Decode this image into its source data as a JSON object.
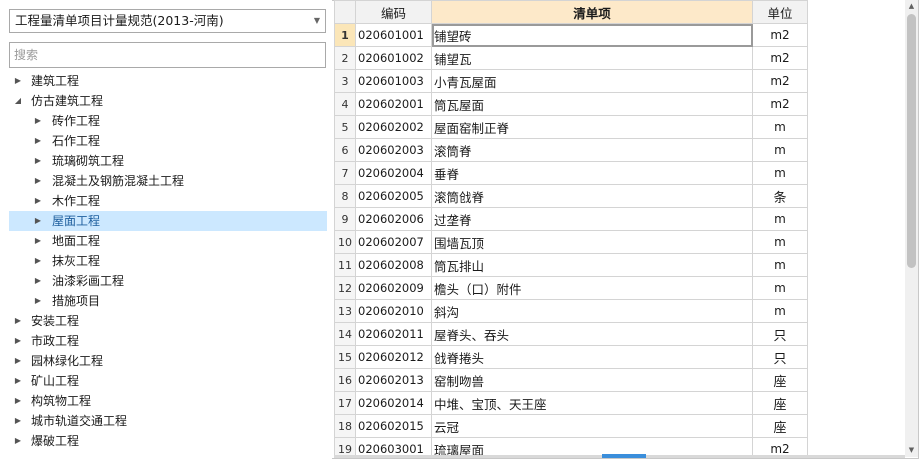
{
  "left_panel": {
    "standard_select": "工程量清单项目计量规范(2013-河南)",
    "search_placeholder": "搜索",
    "tree": [
      {
        "label": "建筑工程",
        "level": 0,
        "expanded": false
      },
      {
        "label": "仿古建筑工程",
        "level": 0,
        "expanded": true
      },
      {
        "label": "砖作工程",
        "level": 1,
        "expanded": false
      },
      {
        "label": "石作工程",
        "level": 1,
        "expanded": false
      },
      {
        "label": "琉璃砌筑工程",
        "level": 1,
        "expanded": false
      },
      {
        "label": "混凝土及钢筋混凝土工程",
        "level": 1,
        "expanded": false
      },
      {
        "label": "木作工程",
        "level": 1,
        "expanded": false
      },
      {
        "label": "屋面工程",
        "level": 1,
        "expanded": false,
        "selected": true
      },
      {
        "label": "地面工程",
        "level": 1,
        "expanded": false
      },
      {
        "label": "抹灰工程",
        "level": 1,
        "expanded": false
      },
      {
        "label": "油漆彩画工程",
        "level": 1,
        "expanded": false
      },
      {
        "label": "措施项目",
        "level": 1,
        "expanded": false
      },
      {
        "label": "安装工程",
        "level": 0,
        "expanded": false
      },
      {
        "label": "市政工程",
        "level": 0,
        "expanded": false
      },
      {
        "label": "园林绿化工程",
        "level": 0,
        "expanded": false
      },
      {
        "label": "矿山工程",
        "level": 0,
        "expanded": false
      },
      {
        "label": "构筑物工程",
        "level": 0,
        "expanded": false
      },
      {
        "label": "城市轨道交通工程",
        "level": 0,
        "expanded": false
      },
      {
        "label": "爆破工程",
        "level": 0,
        "expanded": false
      }
    ]
  },
  "grid": {
    "headers": {
      "num": "",
      "code": "编码",
      "name": "清单项",
      "unit": "单位"
    },
    "active_row": 1,
    "rows": [
      {
        "num": "1",
        "code": "020601001",
        "name": "铺望砖",
        "unit": "m2"
      },
      {
        "num": "2",
        "code": "020601002",
        "name": "铺望瓦",
        "unit": "m2"
      },
      {
        "num": "3",
        "code": "020601003",
        "name": "小青瓦屋面",
        "unit": "m2"
      },
      {
        "num": "4",
        "code": "020602001",
        "name": "筒瓦屋面",
        "unit": "m2"
      },
      {
        "num": "5",
        "code": "020602002",
        "name": "屋面窑制正脊",
        "unit": "m"
      },
      {
        "num": "6",
        "code": "020602003",
        "name": "滚筒脊",
        "unit": "m"
      },
      {
        "num": "7",
        "code": "020602004",
        "name": "垂脊",
        "unit": "m"
      },
      {
        "num": "8",
        "code": "020602005",
        "name": "滚筒戗脊",
        "unit": "条"
      },
      {
        "num": "9",
        "code": "020602006",
        "name": "过垄脊",
        "unit": "m"
      },
      {
        "num": "10",
        "code": "020602007",
        "name": "围墙瓦顶",
        "unit": "m"
      },
      {
        "num": "11",
        "code": "020602008",
        "name": "筒瓦排山",
        "unit": "m"
      },
      {
        "num": "12",
        "code": "020602009",
        "name": "檐头（口）附件",
        "unit": "m"
      },
      {
        "num": "13",
        "code": "020602010",
        "name": "斜沟",
        "unit": "m"
      },
      {
        "num": "14",
        "code": "020602011",
        "name": "屋脊头、吞头",
        "unit": "只"
      },
      {
        "num": "15",
        "code": "020602012",
        "name": "戗脊捲头",
        "unit": "只"
      },
      {
        "num": "16",
        "code": "020602013",
        "name": "窑制吻兽",
        "unit": "座"
      },
      {
        "num": "17",
        "code": "020602014",
        "name": "中堆、宝顶、天王座",
        "unit": "座"
      },
      {
        "num": "18",
        "code": "020602015",
        "name": "云冠",
        "unit": "座"
      },
      {
        "num": "19",
        "code": "020603001",
        "name": "琉璃屋面",
        "unit": "m2"
      }
    ]
  },
  "icons": {
    "dropdown": "chevron-down-icon",
    "collapsed": "caret-right-icon",
    "expanded": "caret-down-icon",
    "scroll_up": "scroll-up-arrow-icon",
    "scroll_down": "scroll-down-arrow-icon"
  },
  "colors": {
    "selection": "#cce8ff",
    "header_highlight": "#fde9c9",
    "active_row_number": "#fbe6b8",
    "splitter_handle": "#3a8edb"
  }
}
